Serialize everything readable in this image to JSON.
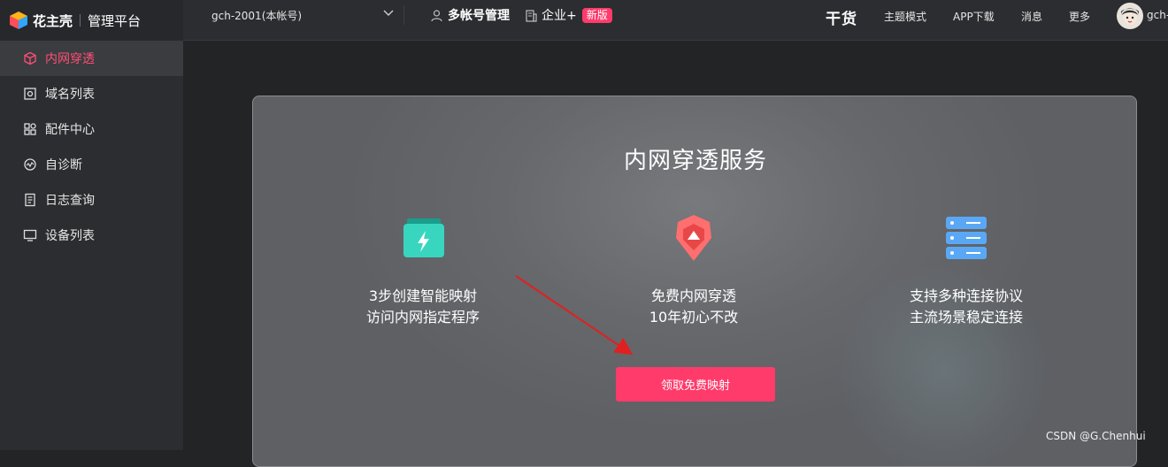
{
  "brand": {
    "name": "花主壳",
    "subtitle": "管理平台"
  },
  "topbar": {
    "account": "gch-2001(本帐号)",
    "multi_account": "多帐号管理",
    "enterprise": "企业+",
    "new_badge": "新版",
    "dry_goods": "干货",
    "nav": [
      "主题模式",
      "APP下载",
      "消息",
      "更多"
    ],
    "username": "gch-"
  },
  "sidebar": {
    "items": [
      {
        "label": "内网穿透",
        "icon": "cube-icon",
        "active": true
      },
      {
        "label": "域名列表",
        "icon": "domain-icon",
        "active": false
      },
      {
        "label": "配件中心",
        "icon": "grid-icon",
        "active": false
      },
      {
        "label": "自诊断",
        "icon": "diagnose-icon",
        "active": false
      },
      {
        "label": "日志查询",
        "icon": "log-icon",
        "active": false
      },
      {
        "label": "设备列表",
        "icon": "monitor-icon",
        "active": false
      }
    ]
  },
  "main": {
    "title": "内网穿透服务",
    "features": [
      {
        "icon": "lightning-card-icon",
        "line1": "3步创建智能映射",
        "line2": "访问内网指定程序"
      },
      {
        "icon": "shield-arrow-icon",
        "line1": "免费内网穿透",
        "line2": "10年初心不改"
      },
      {
        "icon": "server-stack-icon",
        "line1": "支持多种连接协议",
        "line2": "主流场景稳定连接"
      }
    ],
    "cta": "领取免费映射"
  },
  "watermark": "CSDN @G.Chenhui",
  "colors": {
    "accent": "#ff3b6b",
    "sidebar_bg": "#2b2d30",
    "annotation_arrow": "#e02020"
  }
}
